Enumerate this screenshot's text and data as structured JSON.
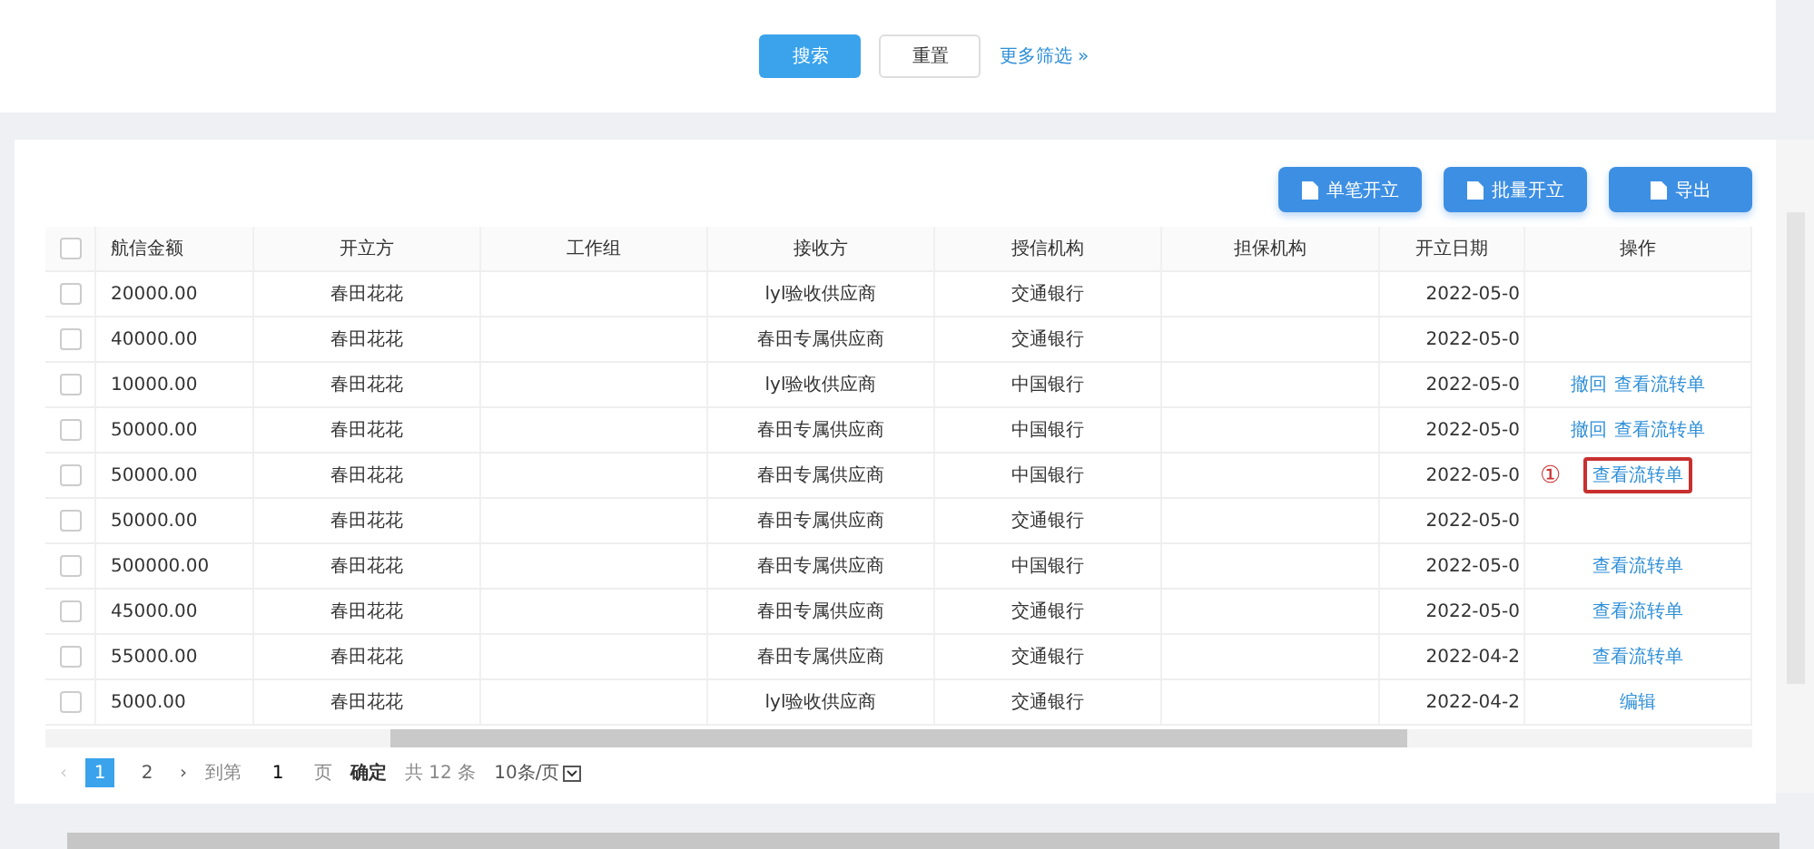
{
  "search_bar": {
    "buttons": [
      {
        "label": "搜索",
        "kind": "primary"
      },
      {
        "label": "重置",
        "kind": "default"
      }
    ],
    "more_filters": {
      "label": "更多筛选",
      "icon": "»"
    }
  },
  "toolbar": {
    "buttons": [
      "单笔开立",
      "批量开立",
      "导出"
    ]
  },
  "table": {
    "all_checked": false,
    "columns": [
      "航信金额",
      "开立方",
      "工作组",
      "接收方",
      "授信机构",
      "担保机构",
      "开立日期",
      "操作"
    ],
    "rows": [
      {
        "checked": false,
        "cells": [
          "20000.00",
          "春田花花",
          "",
          "lyl验收供应商",
          "交通银行",
          "",
          "2022-05-0"
        ],
        "actions": []
      },
      {
        "checked": false,
        "cells": [
          "40000.00",
          "春田花花",
          "",
          "春田专属供应商",
          "交通银行",
          "",
          "2022-05-0"
        ],
        "actions": []
      },
      {
        "checked": false,
        "cells": [
          "10000.00",
          "春田花花",
          "",
          "lyl验收供应商",
          "中国银行",
          "",
          "2022-05-0"
        ],
        "actions": [
          "撤回",
          "查看流转单"
        ]
      },
      {
        "checked": false,
        "cells": [
          "50000.00",
          "春田花花",
          "",
          "春田专属供应商",
          "中国银行",
          "",
          "2022-05-0"
        ],
        "actions": [
          "撤回",
          "查看流转单"
        ]
      },
      {
        "checked": false,
        "cells": [
          "50000.00",
          "春田花花",
          "",
          "春田专属供应商",
          "中国银行",
          "",
          "2022-05-0"
        ],
        "actions": [
          "查看流转单"
        ],
        "annotation": "①",
        "highlighted": true
      },
      {
        "checked": false,
        "cells": [
          "50000.00",
          "春田花花",
          "",
          "春田专属供应商",
          "交通银行",
          "",
          "2022-05-0"
        ],
        "actions": []
      },
      {
        "checked": false,
        "cells": [
          "500000.00",
          "春田花花",
          "",
          "春田专属供应商",
          "中国银行",
          "",
          "2022-05-0"
        ],
        "actions": [
          "查看流转单"
        ]
      },
      {
        "checked": false,
        "cells": [
          "45000.00",
          "春田花花",
          "",
          "春田专属供应商",
          "交通银行",
          "",
          "2022-05-0"
        ],
        "actions": [
          "查看流转单"
        ]
      },
      {
        "checked": false,
        "cells": [
          "55000.00",
          "春田花花",
          "",
          "春田专属供应商",
          "交通银行",
          "",
          "2022-04-2"
        ],
        "actions": [
          "查看流转单"
        ]
      },
      {
        "checked": false,
        "cells": [
          "5000.00",
          "春田花花",
          "",
          "lyl验收供应商",
          "交通银行",
          "",
          "2022-04-2"
        ],
        "actions": [
          "编辑"
        ]
      }
    ]
  },
  "pagination": {
    "prev": {
      "label": "‹",
      "disabled": true
    },
    "pages": [
      {
        "label": "1",
        "selected": true
      },
      {
        "label": "2",
        "selected": false
      }
    ],
    "next": {
      "label": "›",
      "disabled": false
    },
    "goto_label": "到第",
    "goto_value": "1",
    "page_unit": "页",
    "confirm": "确定",
    "total": "共 12 条",
    "page_size": "10条/页"
  }
}
